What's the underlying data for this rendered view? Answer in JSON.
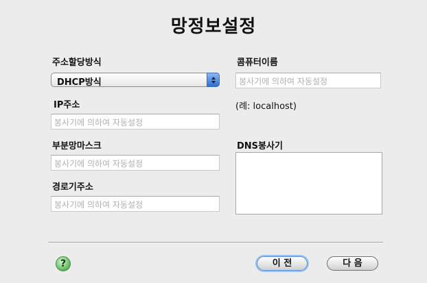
{
  "title": "망정보설정",
  "left": {
    "assign_label": "주소할당방식",
    "assign_value": "DHCP방식",
    "ip_label": "IP주소",
    "ip_placeholder": "봉사기에 의하여 자동설정",
    "subnet_label": "부분망마스크",
    "subnet_placeholder": "봉사기에 의하여 자동설정",
    "gateway_label": "경로기주소",
    "gateway_placeholder": "봉사기에 의하여 자동설정"
  },
  "right": {
    "computer_label": "콤퓨터이름",
    "computer_placeholder": "봉사기에 의하여 자동설정",
    "example": "(례: localhost)",
    "dns_label": "DNS봉사기"
  },
  "footer": {
    "help": "?",
    "prev": "이 전",
    "next": "다 음"
  }
}
